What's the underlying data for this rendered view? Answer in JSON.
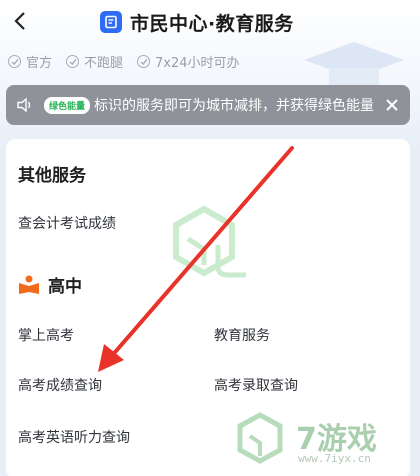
{
  "header": {
    "title": "市民中心·教育服务"
  },
  "tags": [
    {
      "label": "官方"
    },
    {
      "label": "不跑腿"
    },
    {
      "label": "7x24小时可办"
    }
  ],
  "notice": {
    "badge": "绿色能量",
    "text": "标识的服务即可为城市减排，并获得绿色能量"
  },
  "other_services": {
    "title": "其他服务",
    "items": [
      {
        "label": "查会计考试成绩"
      }
    ]
  },
  "high_school": {
    "title": "高中",
    "items": [
      {
        "label": "掌上高考"
      },
      {
        "label": "教育服务"
      },
      {
        "label": "高考成绩查询"
      },
      {
        "label": "高考录取查询"
      },
      {
        "label": "高考英语听力查询"
      }
    ]
  },
  "watermark": {
    "brand": "7游戏",
    "url": "www.7iyx.cn"
  },
  "colors": {
    "accent": "#2f6bf5",
    "notice_bg": "#8f9399",
    "arrow": "#e8322a",
    "orange": "#f26a1b"
  }
}
